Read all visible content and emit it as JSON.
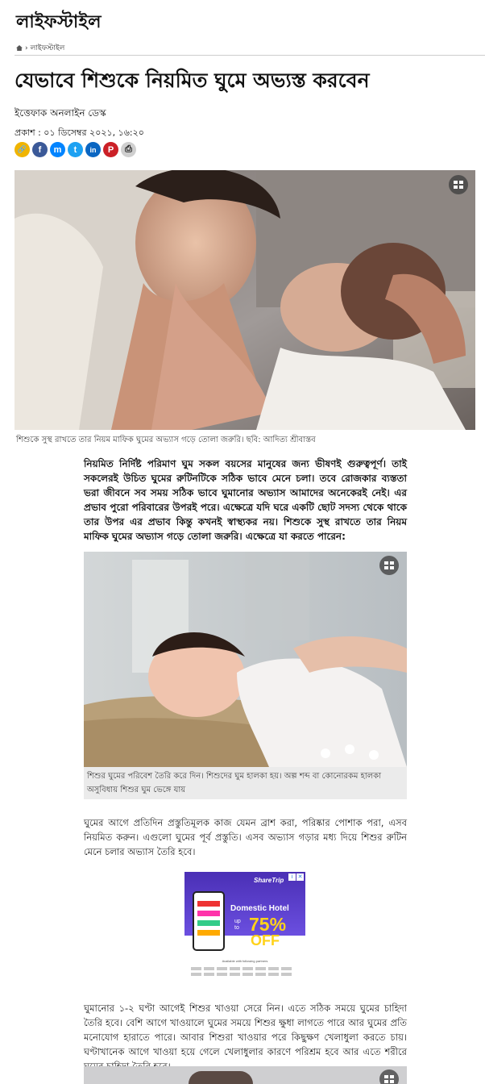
{
  "section": {
    "title": "লাইফস্টাইল"
  },
  "breadcrumb": {
    "home_icon": "home-icon",
    "separator": "›",
    "current": "লাইফস্টাইল"
  },
  "article": {
    "headline": "যেভাবে শিশুকে নিয়মিত ঘুমে অভ্যস্ত করবেন",
    "byline": "ইত্তেফাক অনলাইন ডেস্ক",
    "published": "প্রকাশ : ০১ ডিসেম্বর ২০২১, ১৬:২০",
    "share": [
      {
        "icon": "link-icon",
        "glyph": "🔗",
        "color": "#f0b400"
      },
      {
        "icon": "facebook-icon",
        "glyph": "f",
        "color": "#3b5998"
      },
      {
        "icon": "messenger-icon",
        "glyph": "m",
        "color": "#0084ff"
      },
      {
        "icon": "twitter-icon",
        "glyph": "t",
        "color": "#1da1f2"
      },
      {
        "icon": "linkedin-icon",
        "glyph": "in",
        "color": "#0a66c2"
      },
      {
        "icon": "pinterest-icon",
        "glyph": "P",
        "color": "#cb2027"
      },
      {
        "icon": "print-icon",
        "glyph": "⎙",
        "color": "#cfcfcf"
      }
    ],
    "main_image_caption": "শিশুকে সুস্থ রাখতে তার নিয়ম মাফিক ঘুমের অভ্যাস গড়ে তোলা জরুরি। ছবি: আদিত্য শ্রীবাস্তব",
    "lead": "নিয়মিত নির্দিষ্ট পরিমাণ ঘুম সকল বয়সের মানুষের জন্য ভীষণই গুরুত্বপূর্ণ। তাই সকলেরই উচিত ঘুমের রুটিনটিকে সঠিক ভাবে মেনে চলা। তবে রোজকার ব্যস্ততা ভরা জীবনে সব সময় সঠিক ভাবে ঘুমানোর অভ্যাস আমাদের অনেকেরই নেই। এর প্রভাব পুরো পরিবারের উপরই পরে। এক্ষেত্রে যদি ঘরে একটি ছোট সদস্য থেকে থাকে তার উপর এর প্রভাব কিন্তু কখনই স্বাস্থ্যকর নয়। শিশুকে সুস্থ রাখতে তার নিয়ম মাফিক ঘুমের অভ্যাস গড়ে তোলা জরুরি। এক্ষেত্রে যা করতে পারেন:",
    "second_image_caption": "শিশুর ঘুমের পরিবেশ তৈরি করে দিন। শিশুদের ঘুম হালকা হয়। অল্প শব্দ বা কোনোরকম হালকা অসুবিধায় শিশুর ঘুম ভেঙ্গে যায়",
    "para1": "ঘুমের আগে প্রতিদিন প্রস্তুতিমূলক কাজ যেমন ব্রাশ করা, পরিষ্কার পোশাক পরা, এসব নিয়মিত করুন। এগুলো ঘুমের পূর্ব প্রস্তুতি। এসব অভ্যাস গড়ার মধ্য দিয়ে শিশুর রুটিন মেনে চলার অভ্যাস তৈরি হবে।",
    "para2": "ঘুমানোর ১-২ ঘণ্টা আগেই শিশুর খাওয়া সেরে নিন। এতে সঠিক সময়ে ঘুমের চাহিদা তৈরি হবে। বেশি আগে খাওয়ালে ঘুমের সময়ে শিশুর ক্ষুধা লাগতে পারে আর ঘুমের প্রতি মনোযোগ হারাতে পারে। আবার শিশুরা খাওয়ার পরে কিছুক্ষণ খেলাধুলা করতে চায়। ঘণ্টাখানেক আগে খাওয়া হয়ে গেলে খেলাধুলার কারণে পরিশ্রম হবে আর এতে শরীরে ঘুমের চাহিদা তৈরি হবে।",
    "gallery_icon": "gallery-icon"
  },
  "ad": {
    "brand": "ShareTrip",
    "headline": "Domestic Hotel",
    "up_to": "up to",
    "percent": "75%",
    "off": "OFF",
    "footer": "Available with following partners",
    "close_icons": [
      "info-icon",
      "close-icon"
    ]
  }
}
